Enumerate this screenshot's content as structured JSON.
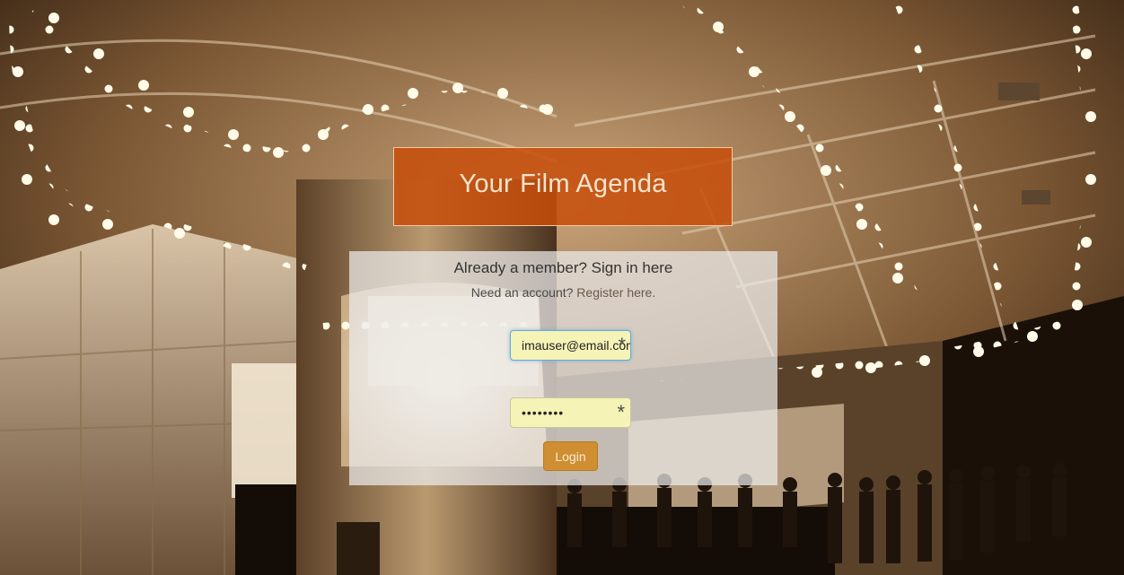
{
  "header": {
    "title": "Your Film Agenda"
  },
  "login_panel": {
    "heading": "Already a member? Sign in here",
    "register_prompt": "Need an account?",
    "register_link": "Register here.",
    "email": {
      "value": "imauser@email.com",
      "required_marker": "*"
    },
    "password": {
      "masked_value": "••••••••",
      "required_marker": "*"
    },
    "login_button": "Login"
  },
  "colors": {
    "title_background": "#c64e0a",
    "login_button": "#cf8e32",
    "field_background": "#f5f3b6",
    "focus_border": "#66a9d9"
  }
}
